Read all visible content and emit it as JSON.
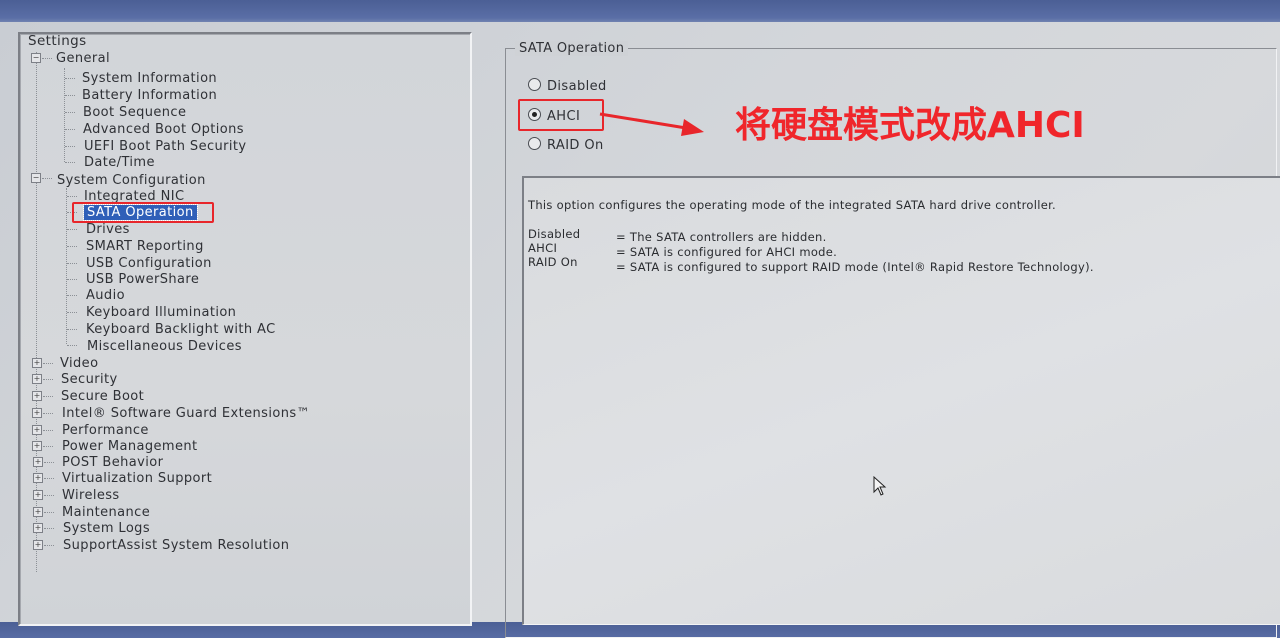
{
  "settings_tree": {
    "root_label": "Settings",
    "general": {
      "label": "General",
      "children": [
        "System Information",
        "Battery Information",
        "Boot Sequence",
        "Advanced Boot Options",
        "UEFI Boot Path Security",
        "Date/Time"
      ]
    },
    "system_configuration": {
      "label": "System Configuration",
      "children": [
        "Integrated NIC",
        "SATA Operation",
        "Drives",
        "SMART Reporting",
        "USB Configuration",
        "USB PowerShare",
        "Audio",
        "Keyboard Illumination",
        "Keyboard Backlight with AC",
        "Miscellaneous Devices"
      ],
      "selected": "SATA Operation"
    },
    "collapsed_sections": [
      "Video",
      "Security",
      "Secure Boot",
      "Intel® Software Guard Extensions™",
      "Performance",
      "Power Management",
      "POST Behavior",
      "Virtualization Support",
      "Wireless",
      "Maintenance",
      "System Logs",
      "SupportAssist System Resolution"
    ]
  },
  "sata_operation": {
    "group_title": "SATA Operation",
    "options": [
      {
        "label": "Disabled",
        "checked": false
      },
      {
        "label": "AHCI",
        "checked": true
      },
      {
        "label": "RAID On",
        "checked": false
      }
    ]
  },
  "help": {
    "intro": "This option configures the operating mode of the integrated SATA hard drive controller.",
    "rows": [
      {
        "term": "Disabled",
        "desc": "= The SATA controllers are hidden."
      },
      {
        "term": "AHCI",
        "desc": "= SATA is configured for AHCI mode."
      },
      {
        "term": "RAID On",
        "desc": "= SATA is configured to support RAID mode (Intel® Rapid Restore Technology)."
      }
    ]
  },
  "annotation": {
    "text": "将硬盘模式改成AHCI",
    "color": "#f0262b"
  },
  "icons": {
    "expander_collapsed": "plus-icon",
    "expander_expanded": "minus-icon",
    "cursor": "mouse-pointer-icon"
  }
}
